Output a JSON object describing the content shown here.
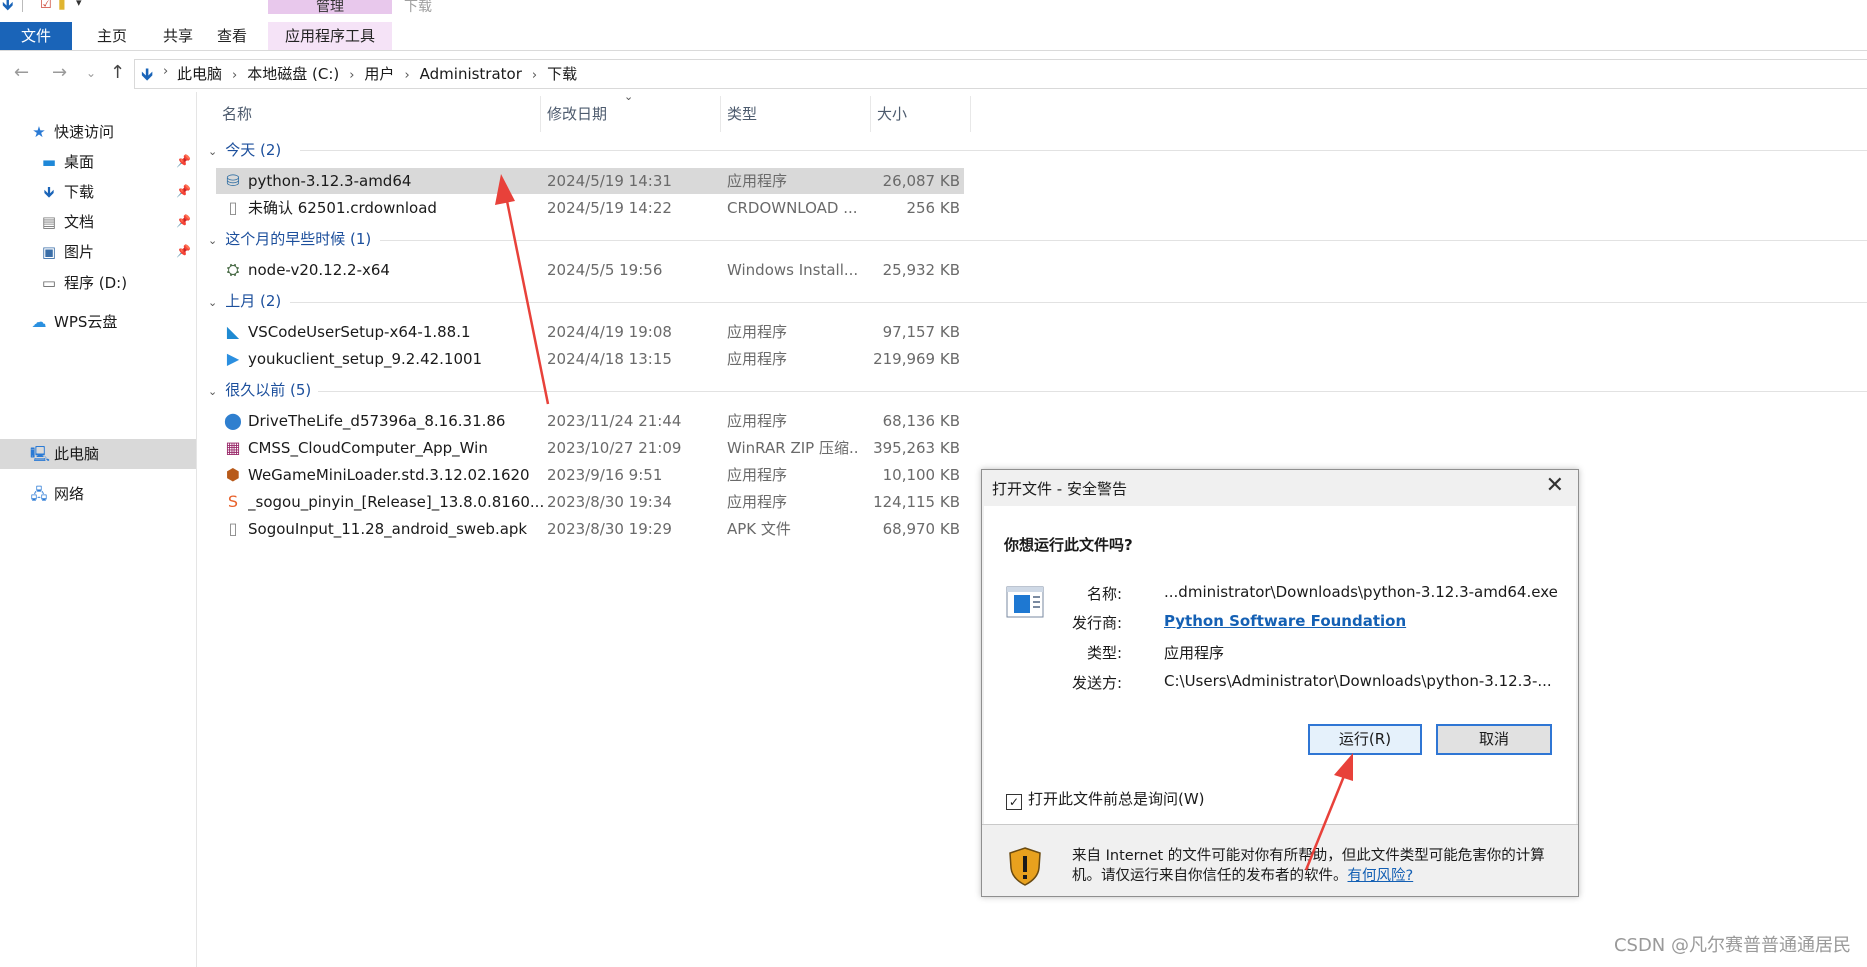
{
  "ribbon": {
    "context_group": "管理",
    "context_group_2": "下载",
    "tabs": [
      "文件",
      "主页",
      "共享",
      "查看",
      "应用程序工具"
    ]
  },
  "address": {
    "crumbs": [
      "此电脑",
      "本地磁盘 (C:)",
      "用户",
      "Administrator",
      "下载"
    ]
  },
  "sidebar": {
    "items": [
      {
        "label": "快速访问",
        "icon": "star-icon"
      },
      {
        "label": "桌面",
        "icon": "desktop-icon"
      },
      {
        "label": "下载",
        "icon": "download-icon"
      },
      {
        "label": "文档",
        "icon": "document-icon"
      },
      {
        "label": "图片",
        "icon": "picture-icon"
      },
      {
        "label": "程序 (D:)",
        "icon": "drive-icon"
      },
      {
        "label": "WPS云盘",
        "icon": "cloud-icon"
      },
      {
        "label": "此电脑",
        "icon": "computer-icon"
      },
      {
        "label": "网络",
        "icon": "network-icon"
      }
    ]
  },
  "columns": [
    "名称",
    "修改日期",
    "类型",
    "大小"
  ],
  "groups": [
    {
      "title": "今天 (2)",
      "files": [
        {
          "name": "python-3.12.3-amd64",
          "date": "2024/5/19 14:31",
          "type": "应用程序",
          "size": "26,087 KB",
          "selected": true
        },
        {
          "name": "未确认 62501.crdownload",
          "date": "2024/5/19 14:22",
          "type": "CRDOWNLOAD ...",
          "size": "256 KB"
        }
      ]
    },
    {
      "title": "这个月的早些时候 (1)",
      "files": [
        {
          "name": "node-v20.12.2-x64",
          "date": "2024/5/5 19:56",
          "type": "Windows Install...",
          "size": "25,932 KB"
        }
      ]
    },
    {
      "title": "上月 (2)",
      "files": [
        {
          "name": "VSCodeUserSetup-x64-1.88.1",
          "date": "2024/4/19 19:08",
          "type": "应用程序",
          "size": "97,157 KB"
        },
        {
          "name": "youkuclient_setup_9.2.42.1001",
          "date": "2024/4/18 13:15",
          "type": "应用程序",
          "size": "219,969 KB"
        }
      ]
    },
    {
      "title": "很久以前 (5)",
      "files": [
        {
          "name": "DriveTheLife_d57396a_8.16.31.86",
          "date": "2023/11/24 21:44",
          "type": "应用程序",
          "size": "68,136 KB"
        },
        {
          "name": "CMSS_CloudComputer_App_Win",
          "date": "2023/10/27 21:09",
          "type": "WinRAR ZIP 压缩...",
          "size": "395,263 KB"
        },
        {
          "name": "WeGameMiniLoader.std.3.12.02.1620",
          "date": "2023/9/16 9:51",
          "type": "应用程序",
          "size": "10,100 KB"
        },
        {
          "name": "_sogou_pinyin_[Release]_13.8.0.8160...",
          "date": "2023/8/30 19:34",
          "type": "应用程序",
          "size": "124,115 KB"
        },
        {
          "name": "SogouInput_11.28_android_sweb.apk",
          "date": "2023/8/30 19:29",
          "type": "APK 文件",
          "size": "68,970 KB"
        }
      ]
    }
  ],
  "dialog": {
    "title": "打开文件 - 安全警告",
    "question": "你想运行此文件吗?",
    "name_label": "名称:",
    "name_value": "...dministrator\\Downloads\\python-3.12.3-amd64.exe",
    "publisher_label": "发行商:",
    "publisher_value": "Python Software Foundation",
    "type_label": "类型:",
    "type_value": "应用程序",
    "from_label": "发送方:",
    "from_value": "C:\\Users\\Administrator\\Downloads\\python-3.12.3-...",
    "run_button": "运行(R)",
    "cancel_button": "取消",
    "checkbox_label": "打开此文件前总是询问(W)",
    "checkbox_checked": true,
    "warning_text": "来自 Internet 的文件可能对你有所帮助，但此文件类型可能危害你的计算机。请仅运行来自你信任的发布者的软件。",
    "warning_link": "有何风险?"
  },
  "watermark": "CSDN @凡尔赛普普通通居民",
  "colors": {
    "accent": "#1a64b8",
    "context_tab": "#e8c8ec",
    "arrow": "#e8413a",
    "link": "#1460b4"
  }
}
